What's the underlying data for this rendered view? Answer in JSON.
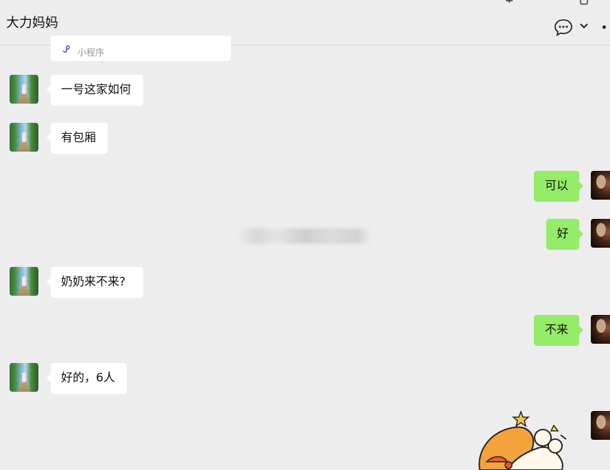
{
  "header": {
    "title": "大力妈妈",
    "icons": [
      "pin-icon",
      "window-icon",
      "chat-bubble-icon",
      "chevron-down-icon",
      "more-icon"
    ]
  },
  "mini_program": {
    "icon": "mini-program-icon",
    "label": "小程序"
  },
  "messages": [
    {
      "side": "left",
      "text": "一号这家如何"
    },
    {
      "side": "left",
      "text": "有包厢"
    },
    {
      "side": "right",
      "text": "可以"
    },
    {
      "side": "right",
      "text": "好"
    },
    {
      "side": "left",
      "text": "奶奶来不来?"
    },
    {
      "side": "right",
      "text": "不来"
    },
    {
      "side": "left",
      "text": "好的，6人"
    }
  ],
  "colors": {
    "background": "#ededed",
    "bubble_left": "#ffffff",
    "bubble_right": "#95ec69"
  }
}
